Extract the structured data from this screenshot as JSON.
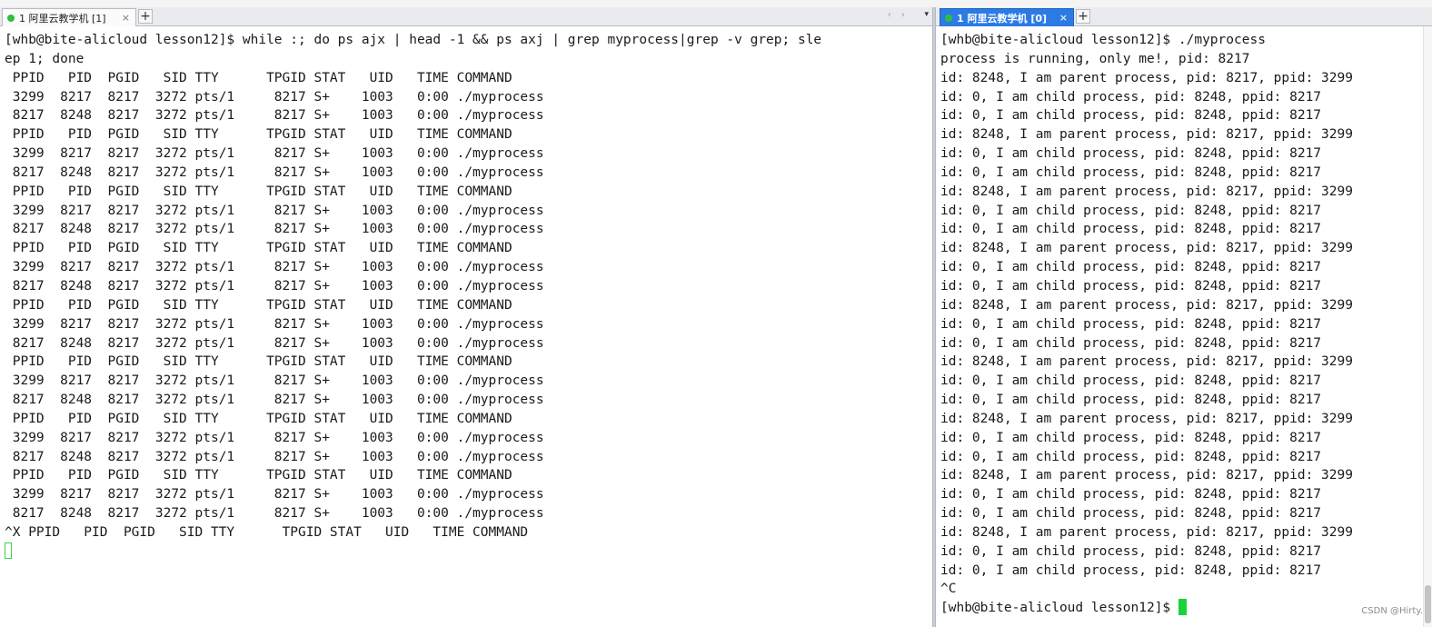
{
  "left_pane": {
    "tab": {
      "label": "1 阿里云教学机 [1]",
      "close": "×",
      "add": "+"
    },
    "nav_arrows": "‹ ›",
    "nav_menu": "▾",
    "lines": [
      "[whb@bite-alicloud lesson12]$ while :; do ps ajx | head -1 && ps axj | grep myprocess|grep -v grep; sle",
      "ep 1; done",
      " PPID   PID  PGID   SID TTY      TPGID STAT   UID   TIME COMMAND",
      " 3299  8217  8217  3272 pts/1     8217 S+    1003   0:00 ./myprocess",
      " 8217  8248  8217  3272 pts/1     8217 S+    1003   0:00 ./myprocess",
      " PPID   PID  PGID   SID TTY      TPGID STAT   UID   TIME COMMAND",
      " 3299  8217  8217  3272 pts/1     8217 S+    1003   0:00 ./myprocess",
      " 8217  8248  8217  3272 pts/1     8217 S+    1003   0:00 ./myprocess",
      " PPID   PID  PGID   SID TTY      TPGID STAT   UID   TIME COMMAND",
      " 3299  8217  8217  3272 pts/1     8217 S+    1003   0:00 ./myprocess",
      " 8217  8248  8217  3272 pts/1     8217 S+    1003   0:00 ./myprocess",
      " PPID   PID  PGID   SID TTY      TPGID STAT   UID   TIME COMMAND",
      " 3299  8217  8217  3272 pts/1     8217 S+    1003   0:00 ./myprocess",
      " 8217  8248  8217  3272 pts/1     8217 S+    1003   0:00 ./myprocess",
      " PPID   PID  PGID   SID TTY      TPGID STAT   UID   TIME COMMAND",
      " 3299  8217  8217  3272 pts/1     8217 S+    1003   0:00 ./myprocess",
      " 8217  8248  8217  3272 pts/1     8217 S+    1003   0:00 ./myprocess",
      " PPID   PID  PGID   SID TTY      TPGID STAT   UID   TIME COMMAND",
      " 3299  8217  8217  3272 pts/1     8217 S+    1003   0:00 ./myprocess",
      " 8217  8248  8217  3272 pts/1     8217 S+    1003   0:00 ./myprocess",
      " PPID   PID  PGID   SID TTY      TPGID STAT   UID   TIME COMMAND",
      " 3299  8217  8217  3272 pts/1     8217 S+    1003   0:00 ./myprocess",
      " 8217  8248  8217  3272 pts/1     8217 S+    1003   0:00 ./myprocess",
      " PPID   PID  PGID   SID TTY      TPGID STAT   UID   TIME COMMAND",
      " 3299  8217  8217  3272 pts/1     8217 S+    1003   0:00 ./myprocess",
      " 8217  8248  8217  3272 pts/1     8217 S+    1003   0:00 ./myprocess",
      "^X PPID   PID  PGID   SID TTY      TPGID STAT   UID   TIME COMMAND"
    ]
  },
  "right_pane": {
    "tab": {
      "label": "1 阿里云教学机 [0]",
      "close": "×",
      "add": "+"
    },
    "lines": [
      "[whb@bite-alicloud lesson12]$ ./myprocess",
      "process is running, only me!, pid: 8217",
      "id: 8248, I am parent process, pid: 8217, ppid: 3299",
      "id: 0, I am child process, pid: 8248, ppid: 8217",
      "id: 0, I am child process, pid: 8248, ppid: 8217",
      "id: 8248, I am parent process, pid: 8217, ppid: 3299",
      "id: 0, I am child process, pid: 8248, ppid: 8217",
      "id: 0, I am child process, pid: 8248, ppid: 8217",
      "id: 8248, I am parent process, pid: 8217, ppid: 3299",
      "id: 0, I am child process, pid: 8248, ppid: 8217",
      "id: 0, I am child process, pid: 8248, ppid: 8217",
      "id: 8248, I am parent process, pid: 8217, ppid: 3299",
      "id: 0, I am child process, pid: 8248, ppid: 8217",
      "id: 0, I am child process, pid: 8248, ppid: 8217",
      "id: 8248, I am parent process, pid: 8217, ppid: 3299",
      "id: 0, I am child process, pid: 8248, ppid: 8217",
      "id: 0, I am child process, pid: 8248, ppid: 8217",
      "id: 8248, I am parent process, pid: 8217, ppid: 3299",
      "id: 0, I am child process, pid: 8248, ppid: 8217",
      "id: 0, I am child process, pid: 8248, ppid: 8217",
      "id: 8248, I am parent process, pid: 8217, ppid: 3299",
      "id: 0, I am child process, pid: 8248, ppid: 8217",
      "id: 0, I am child process, pid: 8248, ppid: 8217",
      "id: 8248, I am parent process, pid: 8217, ppid: 3299",
      "id: 0, I am child process, pid: 8248, ppid: 8217",
      "id: 0, I am child process, pid: 8248, ppid: 8217",
      "id: 8248, I am parent process, pid: 8217, ppid: 3299",
      "id: 0, I am child process, pid: 8248, ppid: 8217",
      "id: 0, I am child process, pid: 8248, ppid: 8217",
      "^C"
    ],
    "prompt": "[whb@bite-alicloud lesson12]$ "
  },
  "watermark": "CSDN @Hirty.",
  "colors": {
    "active_tab": "#2c7be5",
    "status_dot": "#2fbf3f",
    "cursor": "#19d33a"
  }
}
